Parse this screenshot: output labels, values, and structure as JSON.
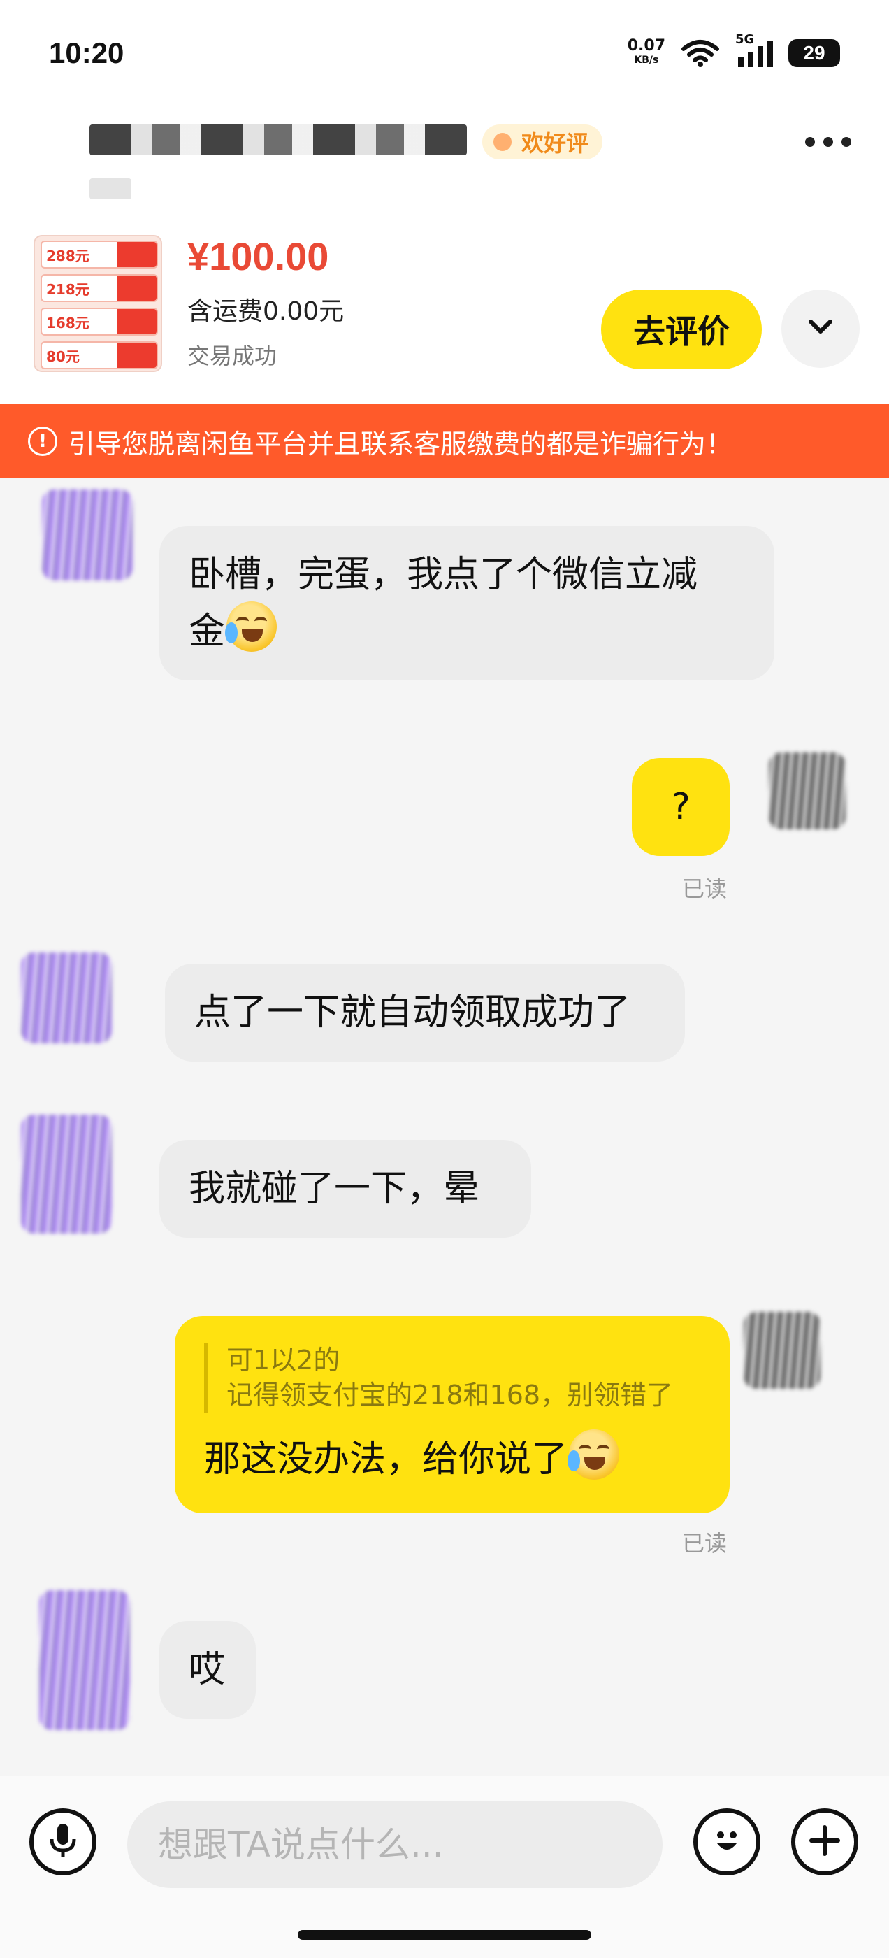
{
  "status_bar": {
    "time": "10:20",
    "net_speed_value": "0.07",
    "net_speed_unit": "KB/s",
    "network_type": "5G",
    "battery": "29"
  },
  "header": {
    "praise_badge": "欢好评"
  },
  "product": {
    "coupons": [
      "288元",
      "218元",
      "168元",
      "80元"
    ],
    "price": "¥100.00",
    "shipping": "含运费0.00元",
    "status": "交易成功",
    "review_button": "去评价"
  },
  "warning": {
    "text": "引导您脱离闲鱼平台并且联系客服缴费的都是诈骗行为！"
  },
  "messages": [
    {
      "side": "in",
      "text": "卧槽，完蛋，我点了个微信立减",
      "text2": "金"
    },
    {
      "side": "out",
      "text": "?",
      "status": "已读"
    },
    {
      "side": "in",
      "text": "点了一下就自动领取成功了"
    },
    {
      "side": "in",
      "text": "我就碰了一下，晕"
    },
    {
      "side": "out",
      "quote_line1": "可1以2的",
      "quote_line2": "记得领支付宝的218和168，别领错了",
      "text": "那这没办法，给你说了",
      "status": "已读"
    },
    {
      "side": "in",
      "text": "哎"
    }
  ],
  "input": {
    "placeholder": "想跟TA说点什么..."
  },
  "colors": {
    "accent_yellow": "#ffe210",
    "price_red": "#e94a36",
    "warning_orange": "#ff5a2a",
    "incoming_bubble": "#ececec"
  }
}
